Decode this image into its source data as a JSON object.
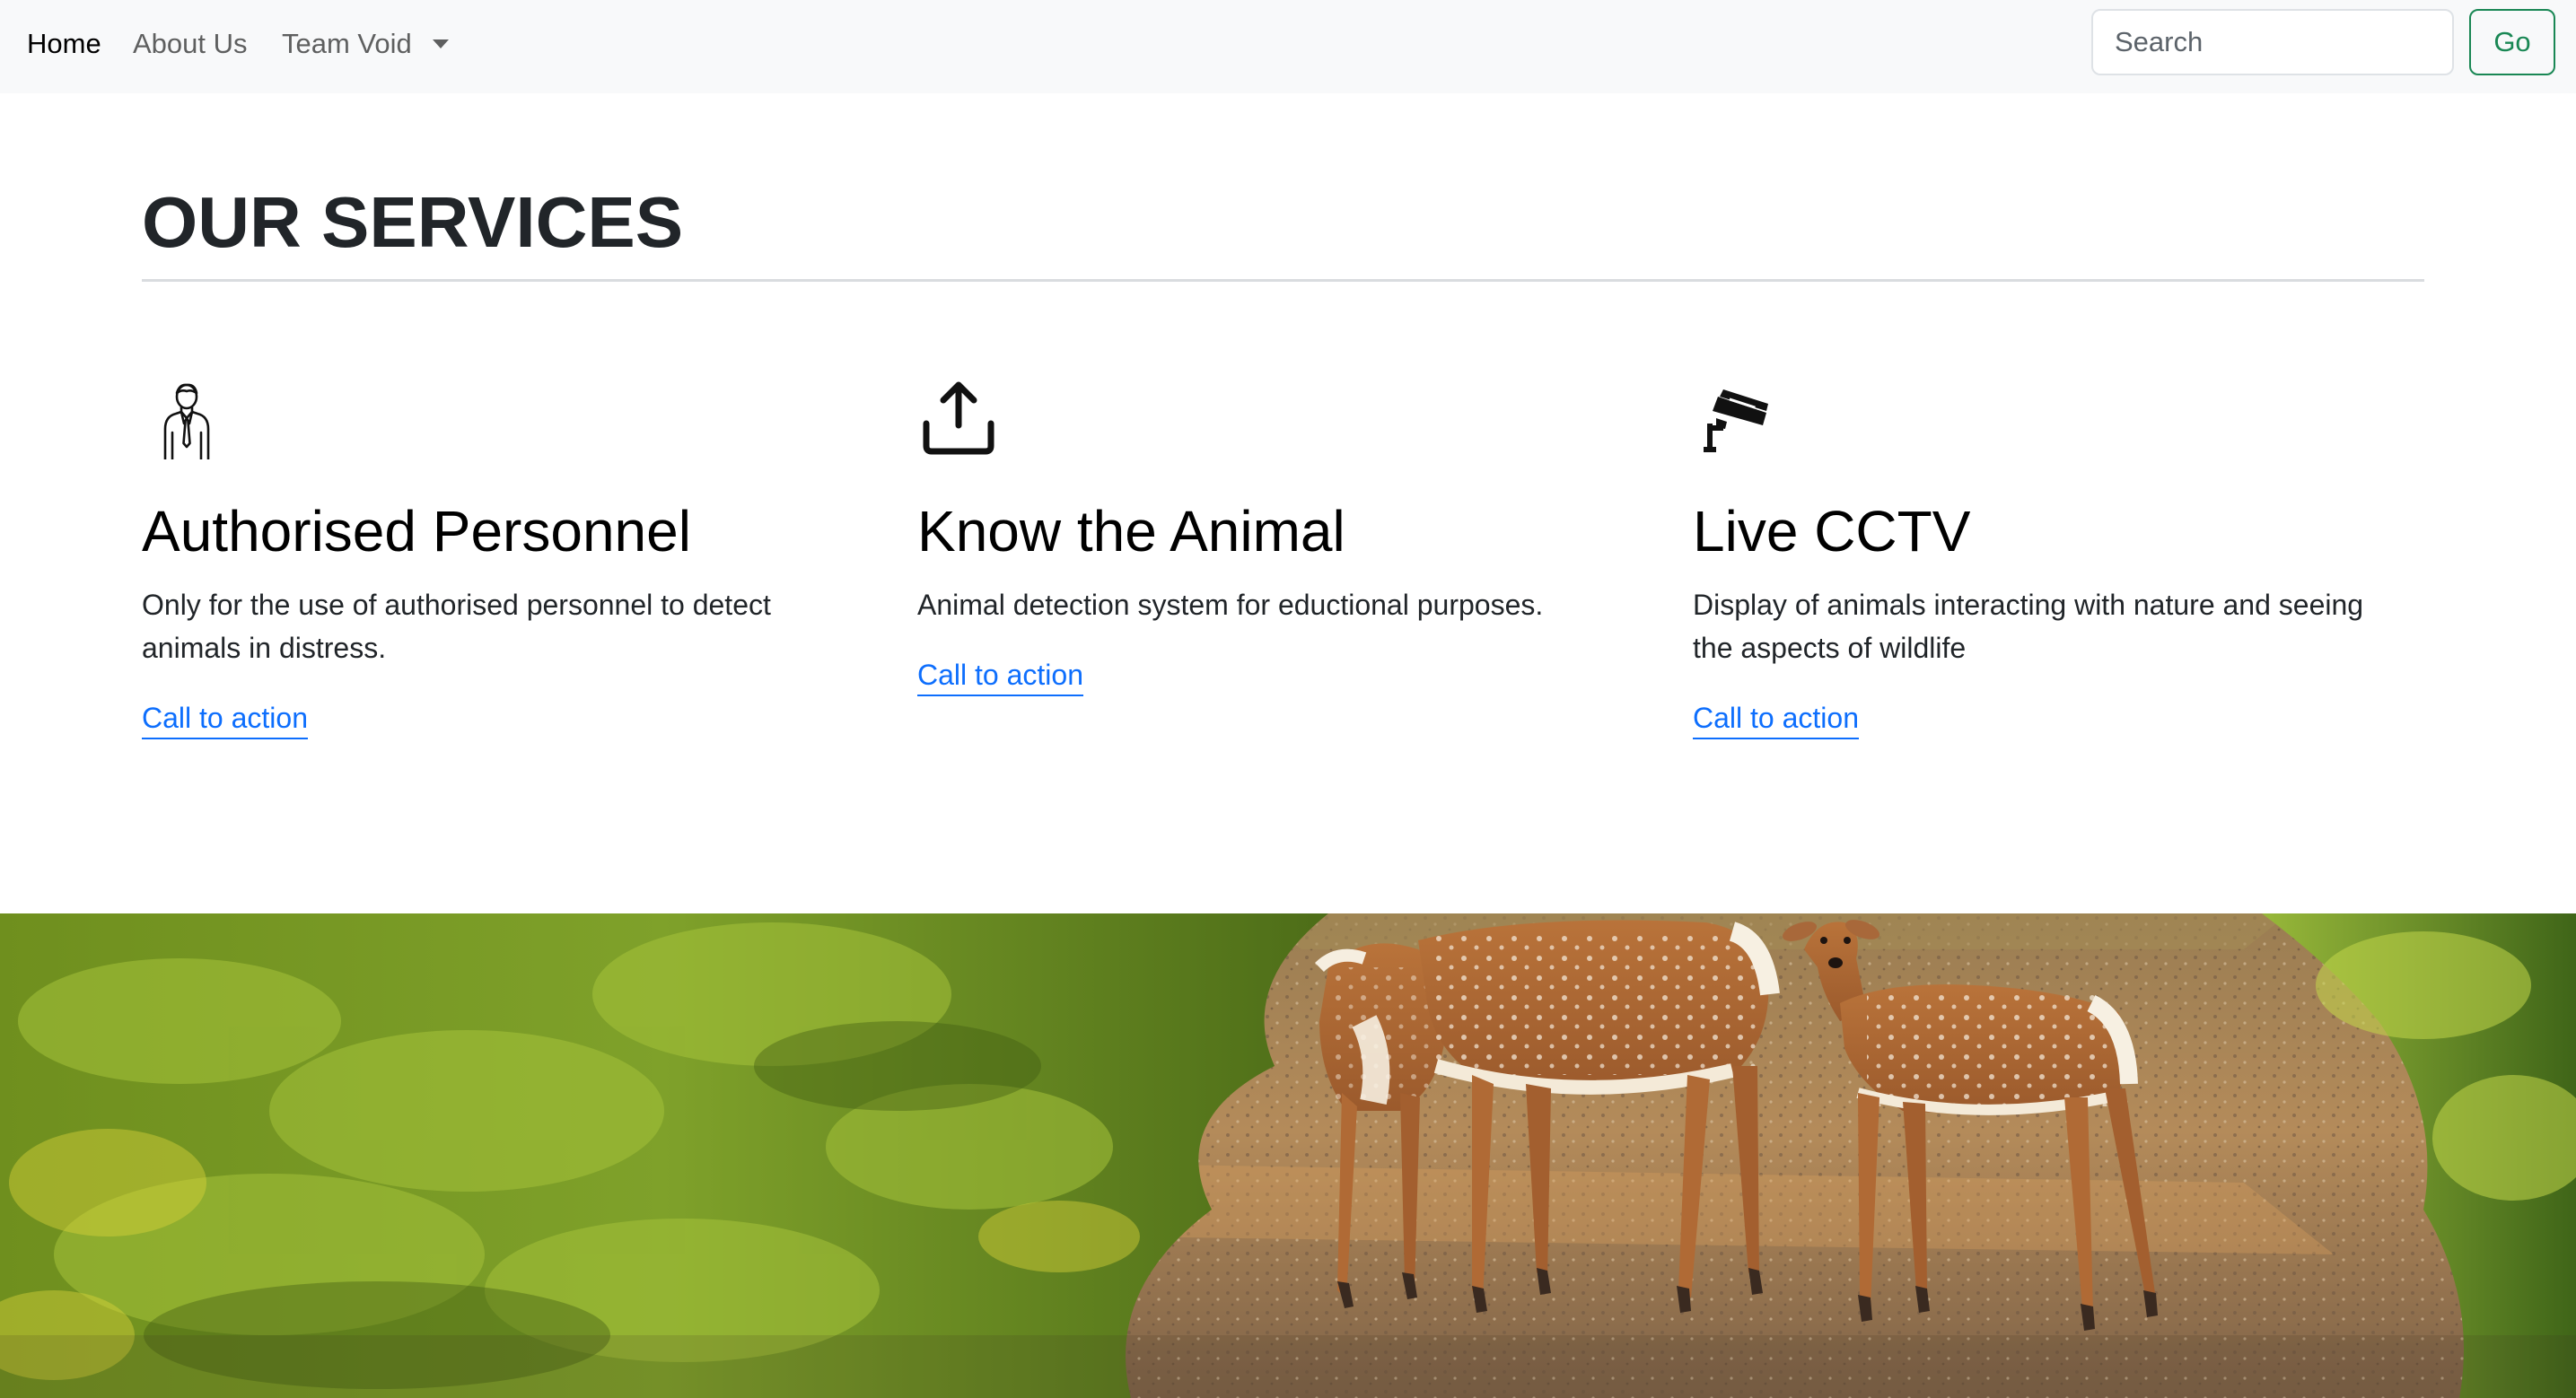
{
  "navbar": {
    "home_label": "Home",
    "about_label": "About Us",
    "team_label": "Team Void",
    "search_placeholder": "Search",
    "go_label": "Go"
  },
  "section": {
    "title": "OUR SERVICES"
  },
  "services": [
    {
      "icon": "personnel-icon",
      "title": "Authorised Personnel",
      "description": "Only for the use of authorised personnel to detect animals in distress.",
      "cta": "Call to action"
    },
    {
      "icon": "upload-icon",
      "title": "Know the Animal",
      "description": "Animal detection system for eductional purposes.",
      "cta": "Call to action"
    },
    {
      "icon": "cctv-camera-icon",
      "title": "Live CCTV",
      "description": "Display of animals interacting with nature and seeing the aspects of wildlife",
      "cta": "Call to action"
    }
  ],
  "hero": {
    "image": "deer-on-forest-path"
  },
  "colors": {
    "navbar_bg": "#f8f9fa",
    "link": "#0d6efd",
    "go_button": "#198754",
    "text": "#212529"
  }
}
